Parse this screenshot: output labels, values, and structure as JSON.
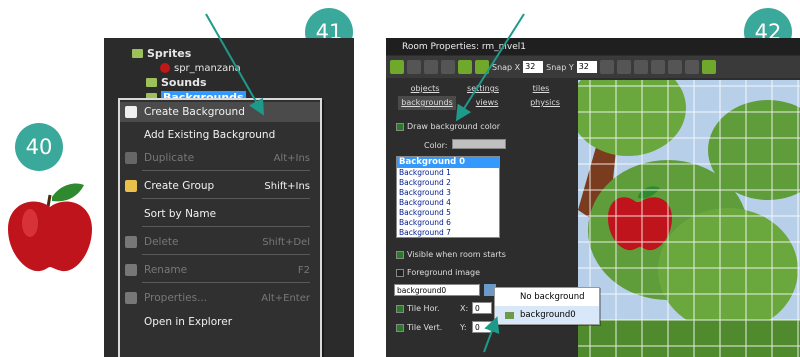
{
  "badges": {
    "step40": "40",
    "step41": "41",
    "step42": "42"
  },
  "tree": {
    "sprites": "Sprites",
    "sprite_item": "spr_manzana",
    "sounds": "Sounds",
    "backgrounds": "Backgrounds"
  },
  "context_menu": {
    "items": [
      {
        "label": "Create Background",
        "shortcut": "",
        "enabled": true,
        "highlighted": true
      },
      {
        "label": "Add Existing Background",
        "shortcut": "",
        "enabled": true
      },
      {
        "label": "Duplicate",
        "shortcut": "Alt+Ins",
        "enabled": false
      },
      {
        "label": "Create Group",
        "shortcut": "Shift+Ins",
        "enabled": true
      },
      {
        "label": "Sort by Name",
        "shortcut": "",
        "enabled": true
      },
      {
        "label": "Delete",
        "shortcut": "Shift+Del",
        "enabled": false
      },
      {
        "label": "Rename",
        "shortcut": "F2",
        "enabled": false
      },
      {
        "label": "Properties...",
        "shortcut": "Alt+Enter",
        "enabled": false
      },
      {
        "label": "Open in Explorer",
        "shortcut": "",
        "enabled": true
      }
    ]
  },
  "room": {
    "title": "Room Properties: rm_nivel1",
    "snap_x_label": "Snap X",
    "snap_x": "32",
    "snap_y_label": "Snap Y",
    "snap_y": "32",
    "tabs": [
      "objects",
      "settings",
      "tiles",
      "backgrounds",
      "views",
      "physics"
    ],
    "active_tab": "backgrounds",
    "draw_bg_color": "Draw background color",
    "color_label": "Color:",
    "backgrounds": [
      "Background 0",
      "Background 1",
      "Background 2",
      "Background 3",
      "Background 4",
      "Background 5",
      "Background 6",
      "Background 7"
    ],
    "visible_label": "Visible when room starts",
    "foreground_label": "Foreground image",
    "bg_field": "background0",
    "tile_hor": "Tile Hor.",
    "tile_vert": "Tile Vert.",
    "x_label": "X:",
    "y_label": "Y:",
    "x_value": "0",
    "y_value": "0",
    "dropdown": [
      "No background",
      "background0"
    ]
  },
  "colors": {
    "badge": "#3aa89a",
    "selection": "#3399ff",
    "arrow": "#1e9a8a"
  },
  "icons": [
    "apple-sprite",
    "folder-icon",
    "picture-icon",
    "copy-icon",
    "folder-create-icon",
    "delete-icon",
    "rename-icon",
    "properties-icon"
  ]
}
